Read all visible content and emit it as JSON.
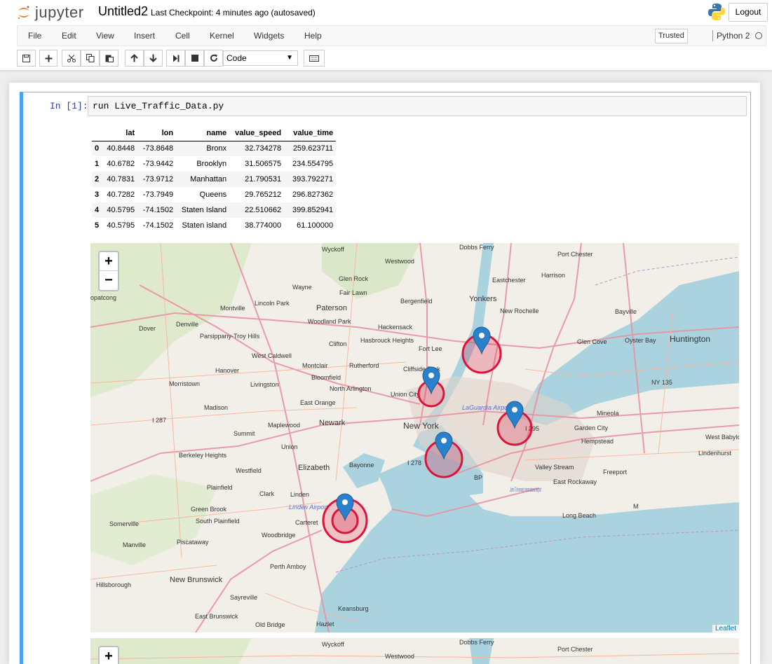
{
  "app": {
    "logo_text": "jupyter",
    "notebook_title": "Untitled2",
    "checkpoint": "Last Checkpoint: 4 minutes ago (autosaved)",
    "logout_label": "Logout"
  },
  "menu": {
    "items": [
      "File",
      "Edit",
      "View",
      "Insert",
      "Cell",
      "Kernel",
      "Widgets",
      "Help"
    ],
    "trusted": "Trusted",
    "kernel": "Python 2"
  },
  "toolbar": {
    "icons": [
      "save-icon",
      "plus-icon",
      "cut-icon",
      "copy-icon",
      "paste-icon",
      "arrow-up-icon",
      "arrow-down-icon",
      "step-forward-icon",
      "stop-icon",
      "restart-icon",
      "keyboard-icon"
    ],
    "cell_type": "Code"
  },
  "cell": {
    "prompt": "In [1]:",
    "code": "run Live_Traffic_Data.py",
    "table": {
      "columns": [
        "",
        "lat",
        "lon",
        "name",
        "value_speed",
        "value_time"
      ],
      "rows": [
        [
          "0",
          "40.8448",
          "-73.8648",
          "Bronx",
          "32.734278",
          "259.623711"
        ],
        [
          "1",
          "40.6782",
          "-73.9442",
          "Brooklyn",
          "31.506575",
          "234.554795"
        ],
        [
          "2",
          "40.7831",
          "-73.9712",
          "Manhattan",
          "21.790531",
          "393.792271"
        ],
        [
          "3",
          "40.7282",
          "-73.7949",
          "Queens",
          "29.765212",
          "296.827362"
        ],
        [
          "4",
          "40.5795",
          "-74.1502",
          "Staten Island",
          "22.510662",
          "399.852941"
        ],
        [
          "5",
          "40.5795",
          "-74.1502",
          "Staten island",
          "38.774000",
          "61.100000"
        ]
      ]
    }
  },
  "map": {
    "zoom_in": "+",
    "zoom_out": "−",
    "attribution": "Leaflet",
    "colors": {
      "water": "#aad3df",
      "land": "#f2efe9",
      "marker": "#2a81cb",
      "circle": "#dc143c"
    },
    "labels": [
      "Dobbs Ferry",
      "Wyckoff",
      "Port Chester",
      "Westwood",
      "Harrison",
      "Glen Rock",
      "Eastchester",
      "Wayne",
      "opatcong",
      "Fair Lawn",
      "Bergenfield",
      "Yonkers",
      "Lincoln Park",
      "Montville",
      "Paterson",
      "New Rochelle",
      "Bayville",
      "Denville",
      "Dover",
      "Woodland Park",
      "Hackensack",
      "Parsippany-Troy Hills",
      "Hasbrouck Heights",
      "Fort Lee",
      "Clifton",
      "Glen Cove",
      "Oyster Bay",
      "Huntington",
      "West Caldwell",
      "Hanover",
      "Montclair",
      "Rutherford",
      "Cliffside Park",
      "Bloomfield",
      "Morristown",
      "Livingston",
      "North Arlington",
      "NY 135",
      "Union City",
      "LaGuardia Airport",
      "East Orange",
      "Madison",
      "Mineola",
      "I 287",
      "Newark",
      "New York",
      "I 295",
      "Garden City",
      "Maplewood",
      "Summit",
      "Hempstead",
      "West Babylon",
      "Union",
      "Berkeley Heights",
      "I 278",
      "Lindenhurst",
      "Elizabeth",
      "Bayonne",
      "Valley Stream",
      "Westfield",
      "Freeport",
      "BP",
      "East Rockaway",
      "Plainfield",
      "Clark",
      "John F. Kennedy International Airport",
      "Linden",
      "Green Brook",
      "Linden Airport",
      "Carteret",
      "Long Beach",
      "Somerville",
      "South Plainfield",
      "Woodbridge",
      "Manville",
      "Piscataway",
      "Perth Amboy",
      "New Brunswick",
      "Hillsborough",
      "Sayreville",
      "Keansburg",
      "East Brunswick",
      "Old Bridge",
      "Hazlet",
      "M"
    ]
  }
}
